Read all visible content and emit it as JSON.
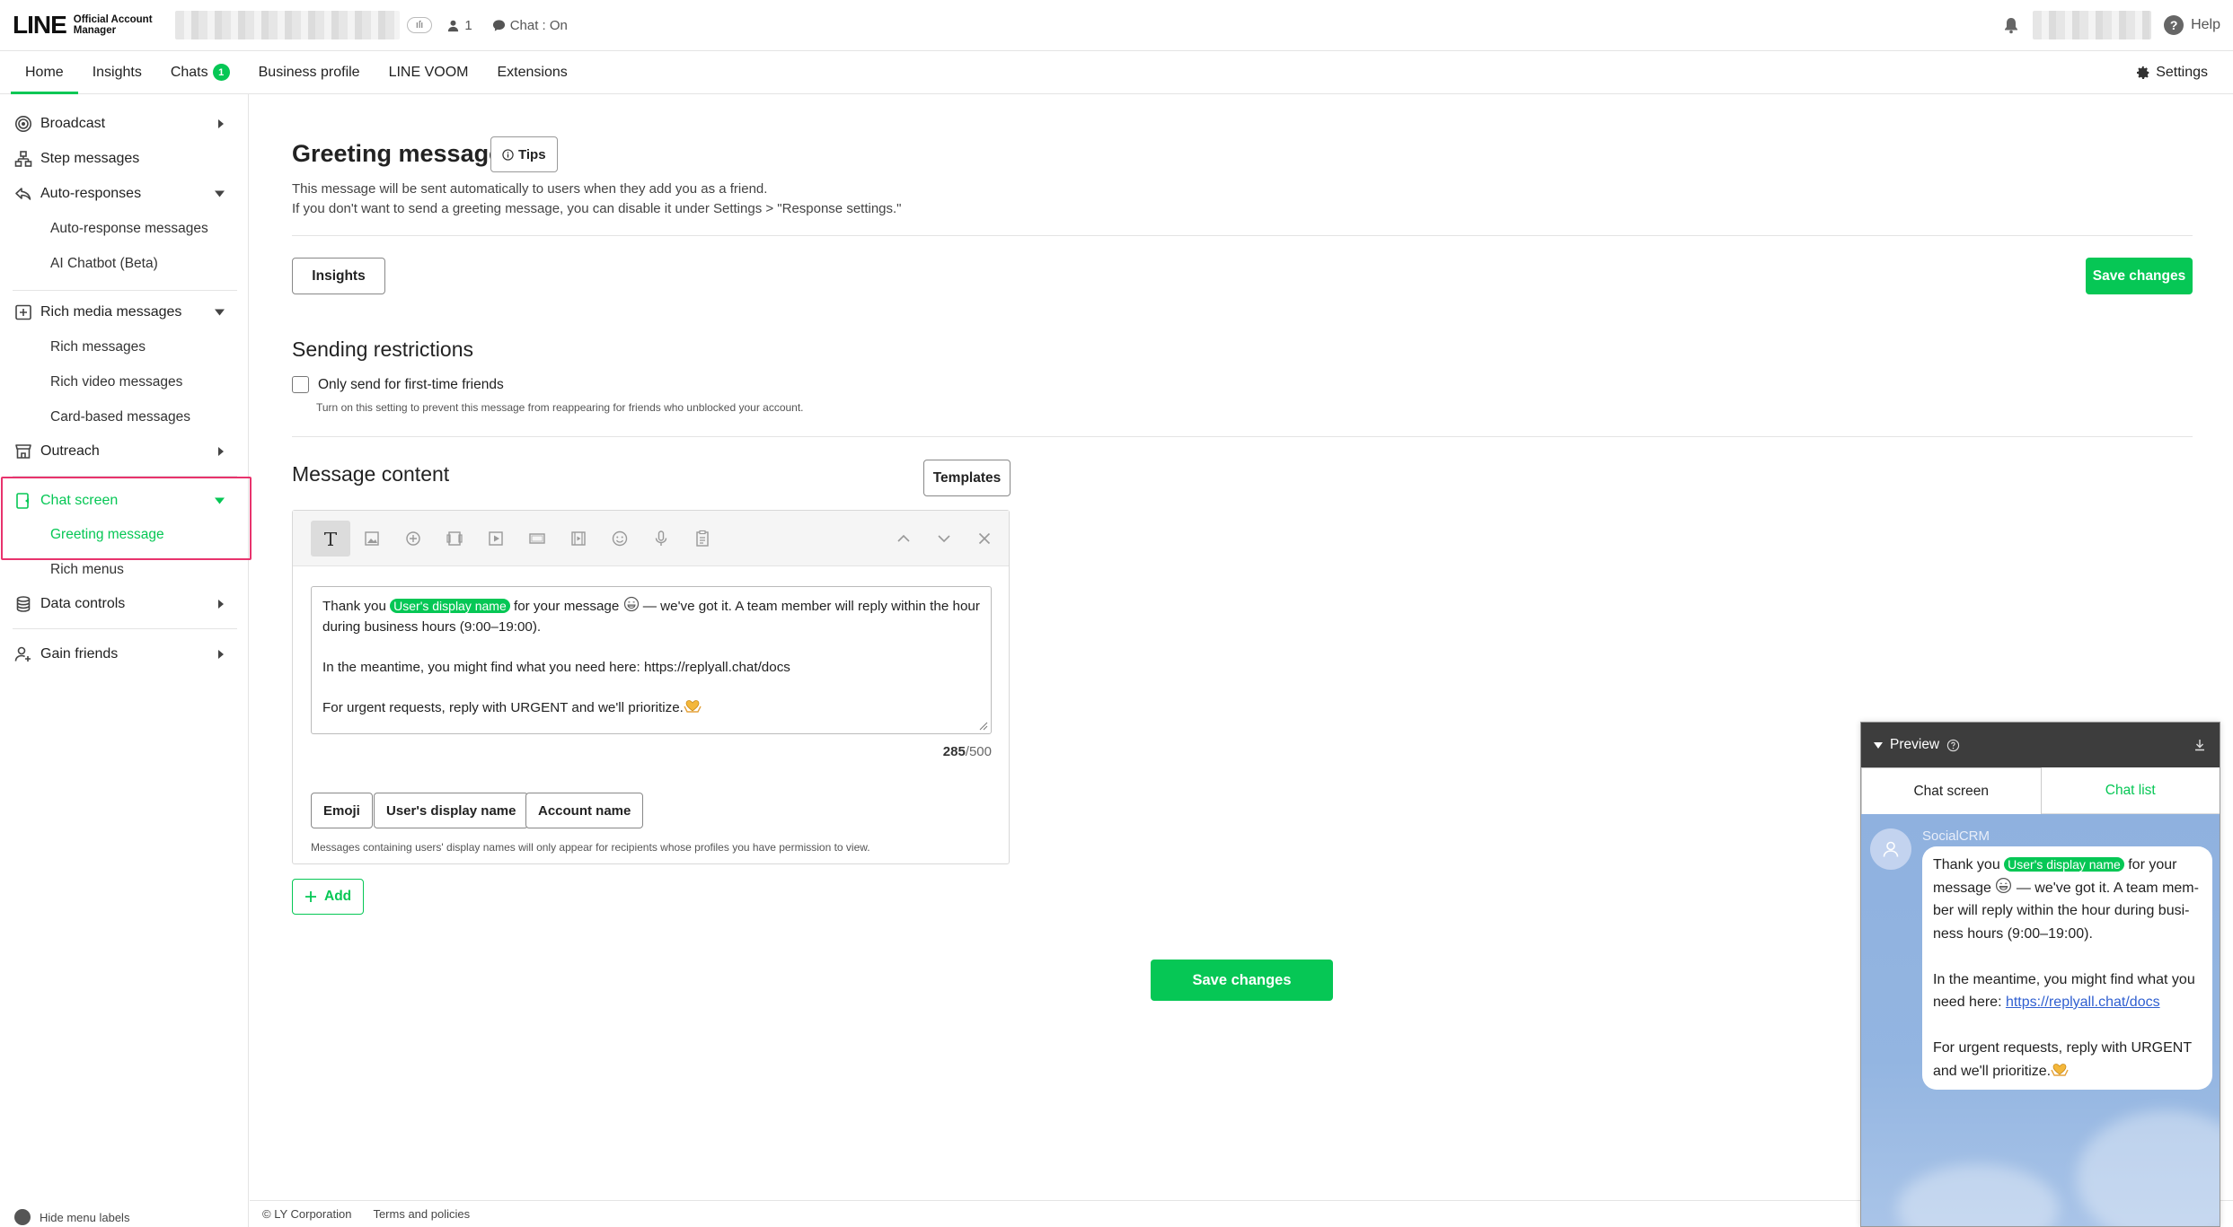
{
  "header": {
    "logo_mark": "LINE",
    "logo_sub": "Official Account Manager",
    "plan_chip": "ıſı",
    "friends_count": "1",
    "chat_status": "Chat : On",
    "help_label": "Help"
  },
  "nav": {
    "tabs": [
      {
        "label": "Home",
        "active": true
      },
      {
        "label": "Insights"
      },
      {
        "label": "Chats",
        "badge": "1"
      },
      {
        "label": "Business profile"
      },
      {
        "label": "LINE VOOM"
      },
      {
        "label": "Extensions"
      }
    ],
    "settings_label": "Settings"
  },
  "sidebar": {
    "broadcast": "Broadcast",
    "step_messages": "Step messages",
    "auto_responses": "Auto-responses",
    "auto_response_messages": "Auto-response messages",
    "ai_chatbot": "AI Chatbot (Beta)",
    "rich_media": "Rich media messages",
    "rich_messages": "Rich messages",
    "rich_video": "Rich video messages",
    "card_based": "Card-based messages",
    "outreach": "Outreach",
    "chat_screen": "Chat screen",
    "greeting_message": "Greeting message",
    "rich_menus": "Rich menus",
    "data_controls": "Data controls",
    "gain_friends": "Gain friends",
    "hide_labels": "Hide menu labels"
  },
  "page": {
    "title": "Greeting message",
    "tips_label": "Tips",
    "desc1": "This message will be sent automatically to users when they add you as a friend.",
    "desc2": "If you don't want to send a greeting message, you can disable it under Settings > \"Response settings.\"",
    "insights_label": "Insights",
    "save_label": "Save changes",
    "sending_title": "Sending restrictions",
    "first_time_label": "Only send for first-time friends",
    "first_time_help": "Turn on this setting to prevent this message from reappearing for friends who unblocked your account.",
    "content_title": "Message content",
    "templates_label": "Templates",
    "add_label": "Add"
  },
  "editor": {
    "msg_pre": "Thank you ",
    "display_name_tag": "User's display name",
    "msg_mid": " for your message ",
    "msg_post": " — we've got it. A team member will reply within the hour during business hours (9:00–19:00).",
    "msg_line2": "In the meantime, you might find what you need here: https://replyall.chat/docs",
    "msg_line3": "For urgent requests, reply with URGENT and we'll prioritize.",
    "char_count": "285",
    "char_max": "/500",
    "emoji_btn": "Emoji",
    "display_name_btn": "User's display name",
    "account_name_btn": "Account name",
    "note": "Messages containing users' display names will only appear for recipients whose profiles you have permission to view."
  },
  "preview": {
    "title": "Preview",
    "tab_chat": "Chat screen",
    "tab_list": "Chat list",
    "sender": "SocialCRM",
    "line1_pre": "Thank you ",
    "line1_post": " for your message ",
    "line1_end": " — we've got it. A team mem-ber will reply within the hour during busi-ness hours (9:00–19:00).",
    "line2_pre": "In the meantime, you might find what you need here: ",
    "line2_link": "https://replyall.chat/docs",
    "line3": "For urgent requests, reply with URGENT and we'll prioritize."
  },
  "footer": {
    "copyright": "© LY Corporation",
    "terms": "Terms and policies"
  },
  "colors": {
    "accent": "#06c755",
    "highlight": "#e8336d",
    "preview_bg": "#8fb1df"
  }
}
